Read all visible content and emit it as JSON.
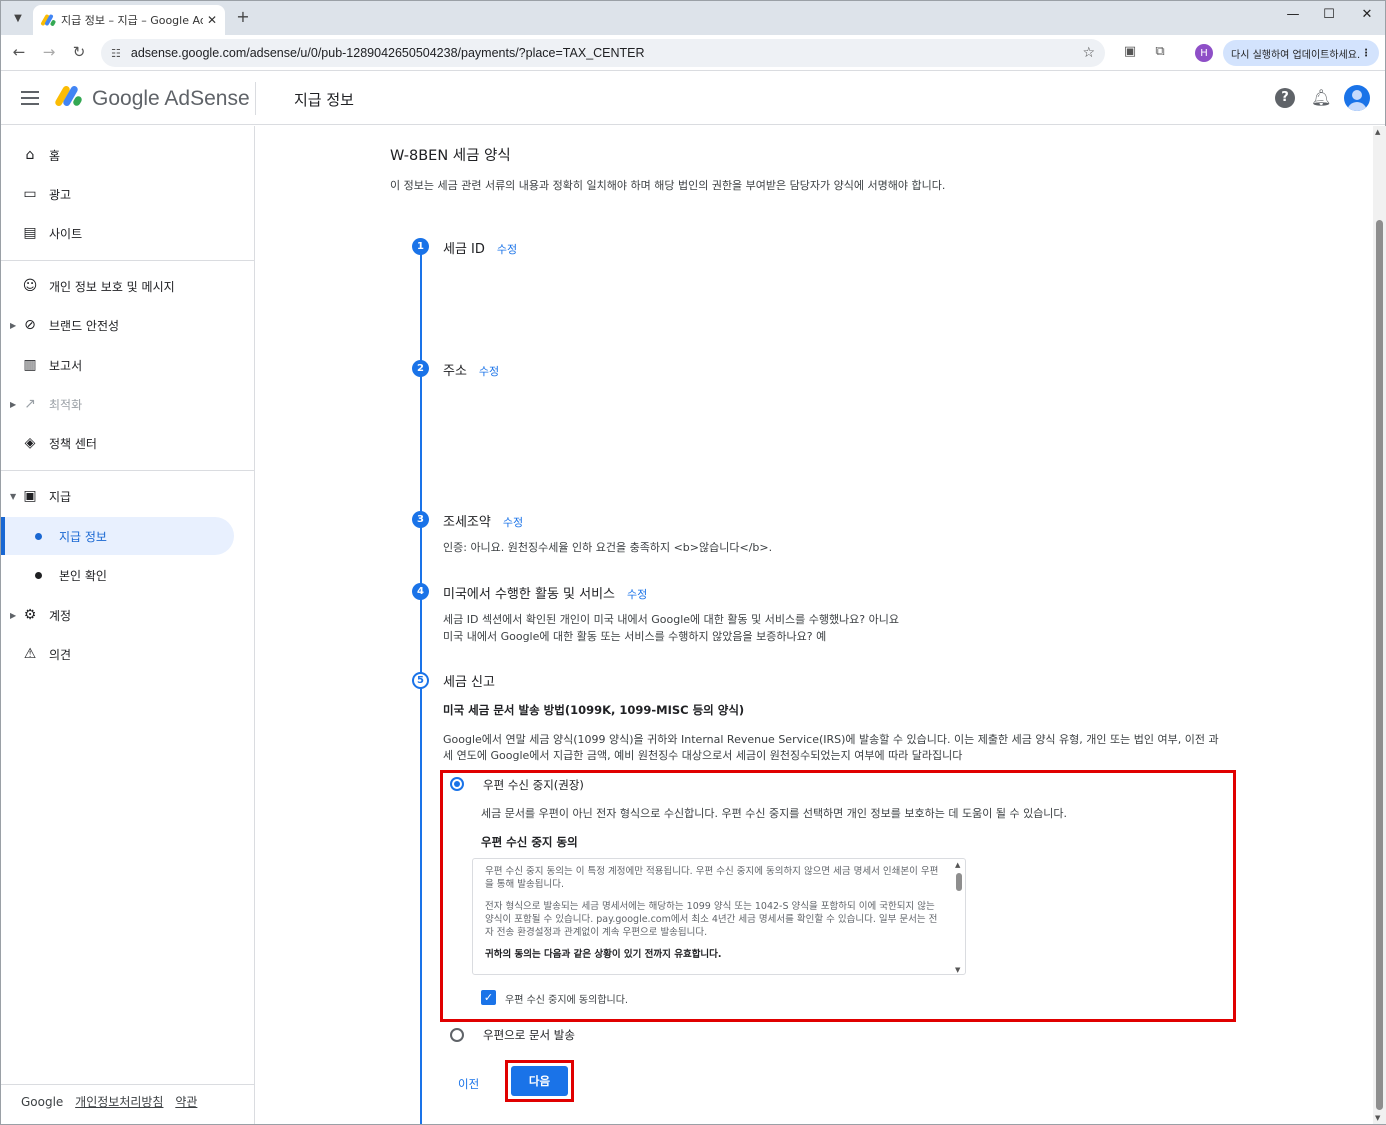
{
  "browser": {
    "tab_title": "지급 정보 – 지급 – Google Ad",
    "url": "adsense.google.com/adsense/u/0/pub-1289042650504238/payments/?place=TAX_CENTER",
    "profile_initial": "H",
    "update_label": "다시 실행하여 업데이트하세요."
  },
  "header": {
    "brand": "Google AdSense",
    "page_title": "지급 정보"
  },
  "sidebar": {
    "items": [
      {
        "label": "홈"
      },
      {
        "label": "광고"
      },
      {
        "label": "사이트"
      },
      {
        "label": "개인 정보 보호 및 메시지"
      },
      {
        "label": "브랜드 안전성"
      },
      {
        "label": "보고서"
      },
      {
        "label": "최적화"
      },
      {
        "label": "정책 센터"
      },
      {
        "label": "지급"
      },
      {
        "label": "지급 정보"
      },
      {
        "label": "본인 확인"
      },
      {
        "label": "계정"
      },
      {
        "label": "의견"
      }
    ],
    "footer": {
      "brand": "Google",
      "privacy": "개인정보처리방침",
      "terms": "약관"
    }
  },
  "form": {
    "title": "W-8BEN 세금 양식",
    "description": "이 정보는 세금 관련 서류의 내용과 정확히 일치해야 하며 해당 법인의 권한을 부여받은 담당자가 양식에 서명해야 합니다.",
    "edit_label": "수정",
    "steps": [
      {
        "number": "1",
        "title": "세금 ID"
      },
      {
        "number": "2",
        "title": "주소"
      },
      {
        "number": "3",
        "title": "조세조약",
        "text": "인증: 아니요. 원천징수세율 인하 요건을 충족하지 <b>않습니다</b>."
      },
      {
        "number": "4",
        "title": "미국에서 수행한 활동 및 서비스",
        "text1": "세금 ID 섹션에서 확인된 개인이 미국 내에서 Google에 대한 활동 및 서비스를 수행했나요? 아니요",
        "text2": "미국 내에서 Google에 대한 활동 또는 서비스를 수행하지 않았음을 보증하나요? 예"
      },
      {
        "number": "5",
        "title": "세금 신고"
      }
    ],
    "delivery_heading": "미국 세금 문서 발송 방법(1099K, 1099-MISC 등의 양식)",
    "delivery_text": "Google에서 연말 세금 양식(1099 양식)을 귀하와 Internal Revenue Service(IRS)에 발송할 수 있습니다. 이는 제출한 세금 양식 유형, 개인 또는 법인 여부, 이전 과세 연도에 Google에서 지급한 금액, 예비 원천징수 대상으로서 세금이 원천징수되었는지 여부에 따라 달라집니다",
    "option_paperless": {
      "label": "우편 수신 중지(권장)",
      "selected": true,
      "description": "세금 문서를 우편이 아닌 전자 형식으로 수신합니다. 우편 수신 중지를 선택하면 개인 정보를 보호하는 데 도움이 될 수 있습니다.",
      "consent_heading": "우편 수신 중지 동의",
      "consent_p1": "우편 수신 중지 동의는 이 특정 계정에만 적용됩니다.  우편 수신 중지에 동의하지 않으면 세금 명세서 인쇄본이 우편을 통해 발송됩니다.",
      "consent_p2": "전자 형식으로 발송되는 세금 명세서에는 해당하는 1099 양식 또는 1042-S 양식을 포함하되 이에 국한되지 않는 양식이 포함될 수 있습니다. pay.google.com에서 최소 4년간 세금 명세서를 확인할 수 있습니다. 일부 문서는 전자 전송 환경설정과 관계없이 계속 우편으로 발송됩니다.",
      "consent_p3": "귀하의 동의는 다음과 같은 상황이 있기 전까지 유효합니다.",
      "checkbox_label": "우편 수신 중지에 동의합니다.",
      "checked": true
    },
    "option_mail": {
      "label": "우편으로 문서 발송",
      "selected": false
    },
    "prev_label": "이전",
    "next_label": "다음"
  },
  "colors": {
    "accent": "#1a73e8",
    "highlight": "#e00000"
  }
}
